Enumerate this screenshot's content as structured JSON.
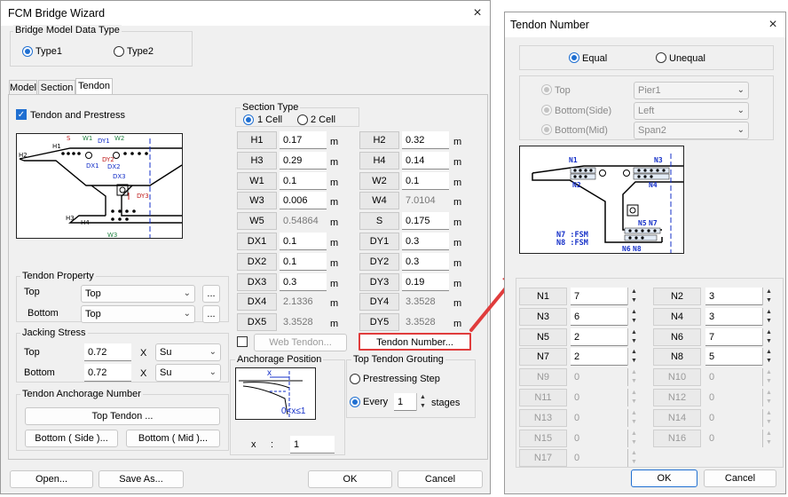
{
  "wizard": {
    "title": "FCM Bridge Wizard",
    "close_icon": "×",
    "bridge_model_data_type": {
      "label": "Bridge Model Data Type",
      "options": [
        "Type1",
        "Type2"
      ],
      "selected": "Type1"
    },
    "tabs": [
      {
        "label": "Model",
        "active": false
      },
      {
        "label": "Section",
        "active": false
      },
      {
        "label": "Tendon",
        "active": true
      }
    ],
    "tendon_and_prestress": {
      "label": "Tendon and Prestress",
      "checked": true
    },
    "diagram_labels": [
      "H1",
      "H2",
      "S",
      "W1",
      "DY1",
      "W2",
      "DX1",
      "DY2",
      "DX2",
      "DX3",
      "DY3",
      "H3",
      "H4",
      "W3"
    ],
    "section_type": {
      "label": "Section Type",
      "options": [
        "1 Cell",
        "2 Cell"
      ],
      "selected": "1 Cell"
    },
    "params_left": [
      {
        "name": "H1",
        "value": "0.17",
        "unit": "m",
        "editable": true
      },
      {
        "name": "H3",
        "value": "0.29",
        "unit": "m",
        "editable": true
      },
      {
        "name": "W1",
        "value": "0.1",
        "unit": "m",
        "editable": true
      },
      {
        "name": "W3",
        "value": "0.006",
        "unit": "m",
        "editable": true
      },
      {
        "name": "W5",
        "value": "0.54864",
        "unit": "m",
        "editable": false
      },
      {
        "name": "DX1",
        "value": "0.1",
        "unit": "m",
        "editable": true
      },
      {
        "name": "DX2",
        "value": "0.1",
        "unit": "m",
        "editable": true
      },
      {
        "name": "DX3",
        "value": "0.3",
        "unit": "m",
        "editable": true
      },
      {
        "name": "DX4",
        "value": "2.1336",
        "unit": "m",
        "editable": false
      },
      {
        "name": "DX5",
        "value": "3.3528",
        "unit": "m",
        "editable": false
      }
    ],
    "params_right": [
      {
        "name": "H2",
        "value": "0.32",
        "unit": "m",
        "editable": true
      },
      {
        "name": "H4",
        "value": "0.14",
        "unit": "m",
        "editable": true
      },
      {
        "name": "W2",
        "value": "0.1",
        "unit": "m",
        "editable": true
      },
      {
        "name": "W4",
        "value": "7.0104",
        "unit": "m",
        "editable": false
      },
      {
        "name": "S",
        "value": "0.175",
        "unit": "m",
        "editable": true
      },
      {
        "name": "DY1",
        "value": "0.3",
        "unit": "m",
        "editable": true
      },
      {
        "name": "DY2",
        "value": "0.3",
        "unit": "m",
        "editable": true
      },
      {
        "name": "DY3",
        "value": "0.19",
        "unit": "m",
        "editable": true
      },
      {
        "name": "DY4",
        "value": "3.3528",
        "unit": "m",
        "editable": false
      },
      {
        "name": "DY5",
        "value": "3.3528",
        "unit": "m",
        "editable": false
      }
    ],
    "tendon_property": {
      "label": "Tendon Property",
      "top_label": "Top",
      "top_value": "Top",
      "bottom_label": "Bottom",
      "bottom_value": "Top",
      "browse": "..."
    },
    "jacking_stress": {
      "label": "Jacking Stress",
      "top_label": "Top",
      "top_value": "0.72",
      "bottom_label": "Bottom",
      "bottom_value": "0.72",
      "x": "X",
      "unit_value": "Su"
    },
    "tendon_anchorage_number": {
      "label": "Tendon Anchorage Number",
      "top_button": "Top Tendon ...",
      "bottom_side_button": "Bottom ( Side )...",
      "bottom_mid_button": "Bottom ( Mid )..."
    },
    "web_tendon": {
      "label": "Web Tendon...",
      "checked": false
    },
    "tendon_number_button": "Tendon Number...",
    "anchorage_position": {
      "label": "Anchorage Position",
      "diagram_x": "x",
      "diagram_range": "0<x≤1",
      "x_label": "x",
      "colon": ":",
      "x_value": "1"
    },
    "top_tendon_grouting": {
      "label": "Top Tendon Grouting",
      "options": [
        "Prestressing Step",
        "Every"
      ],
      "selected": "Every",
      "every_value": "1",
      "stages_label": "stages"
    },
    "footer": {
      "open": "Open...",
      "save_as": "Save As...",
      "ok": "OK",
      "cancel": "Cancel"
    }
  },
  "tendon_number": {
    "title": "Tendon Number",
    "close_icon": "×",
    "mode": {
      "options": [
        "Equal",
        "Unequal"
      ],
      "selected": "Equal"
    },
    "positions": [
      {
        "label": "Top",
        "value": "Pier1"
      },
      {
        "label": "Bottom(Side)",
        "value": "Left"
      },
      {
        "label": "Bottom(Mid)",
        "value": "Span2"
      }
    ],
    "diagram_labels": [
      "N1",
      "N3",
      "N2",
      "N4",
      "N5",
      "N7",
      "N6",
      "N8"
    ],
    "diagram_note_1": "N7 :FSM",
    "diagram_note_2": "N8 :FSM",
    "fields": [
      {
        "name": "N1",
        "value": "7",
        "enabled": true
      },
      {
        "name": "N2",
        "value": "3",
        "enabled": true
      },
      {
        "name": "N3",
        "value": "6",
        "enabled": true
      },
      {
        "name": "N4",
        "value": "3",
        "enabled": true
      },
      {
        "name": "N5",
        "value": "2",
        "enabled": true
      },
      {
        "name": "N6",
        "value": "7",
        "enabled": true
      },
      {
        "name": "N7",
        "value": "2",
        "enabled": true
      },
      {
        "name": "N8",
        "value": "5",
        "enabled": true
      },
      {
        "name": "N9",
        "value": "0",
        "enabled": false
      },
      {
        "name": "N10",
        "value": "0",
        "enabled": false
      },
      {
        "name": "N11",
        "value": "0",
        "enabled": false
      },
      {
        "name": "N12",
        "value": "0",
        "enabled": false
      },
      {
        "name": "N13",
        "value": "0",
        "enabled": false
      },
      {
        "name": "N14",
        "value": "0",
        "enabled": false
      },
      {
        "name": "N15",
        "value": "0",
        "enabled": false
      },
      {
        "name": "N16",
        "value": "0",
        "enabled": false
      },
      {
        "name": "N17",
        "value": "0",
        "enabled": false
      }
    ],
    "footer": {
      "ok": "OK",
      "cancel": "Cancel"
    }
  },
  "colors": {
    "accent": "#1f6fd1",
    "highlight": "#e03c3c",
    "diagram_blue": "#1530c8",
    "diagram_red": "#c02020",
    "diagram_green": "#208040"
  }
}
